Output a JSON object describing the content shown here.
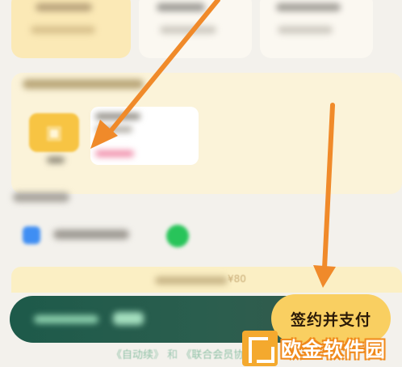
{
  "plans": [
    {
      "name": "plan-card-1",
      "selected": true
    },
    {
      "name": "plan-card-2",
      "selected": false
    },
    {
      "name": "plan-card-3",
      "selected": false
    }
  ],
  "promo": {
    "price_text": "¥80"
  },
  "pay_bar": {
    "button_label": "签约并支付"
  },
  "agreement": {
    "link_1": "《自动续",
    "link_1_tail": "》",
    "separator": "和",
    "link_2": "《联合会员协议》"
  },
  "watermark": {
    "text": "欧金软件园"
  },
  "colors": {
    "accent_gold": "#f9cf61",
    "pay_bar_green": "#1d5a4a",
    "annotation_arrow": "#f08a2a"
  }
}
